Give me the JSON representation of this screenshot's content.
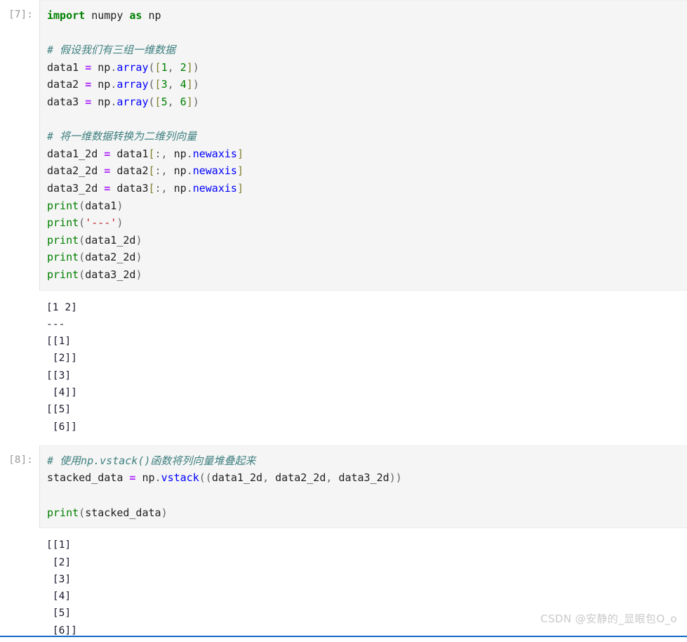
{
  "notebook": {
    "cells": [
      {
        "id": "cell-7",
        "prompt": "[7]:",
        "input_lines": [
          [
            {
              "t": "import",
              "c": "kw"
            },
            {
              "t": " ",
              "c": "op"
            },
            {
              "t": "numpy",
              "c": "name"
            },
            {
              "t": " ",
              "c": "op"
            },
            {
              "t": "as",
              "c": "kw"
            },
            {
              "t": " ",
              "c": "op"
            },
            {
              "t": "np",
              "c": "name"
            }
          ],
          [],
          [
            {
              "t": "# 假设我们有三组一维数据",
              "c": "comment"
            }
          ],
          [
            {
              "t": "data1 ",
              "c": "name"
            },
            {
              "t": "=",
              "c": "assign"
            },
            {
              "t": " np",
              "c": "name"
            },
            {
              "t": ".",
              "c": "op"
            },
            {
              "t": "array",
              "c": "func"
            },
            {
              "t": "(",
              "c": "op"
            },
            {
              "t": "[",
              "c": "brack"
            },
            {
              "t": "1",
              "c": "num"
            },
            {
              "t": ", ",
              "c": "op"
            },
            {
              "t": "2",
              "c": "num"
            },
            {
              "t": "]",
              "c": "brack"
            },
            {
              "t": ")",
              "c": "op"
            }
          ],
          [
            {
              "t": "data2 ",
              "c": "name"
            },
            {
              "t": "=",
              "c": "assign"
            },
            {
              "t": " np",
              "c": "name"
            },
            {
              "t": ".",
              "c": "op"
            },
            {
              "t": "array",
              "c": "func"
            },
            {
              "t": "(",
              "c": "op"
            },
            {
              "t": "[",
              "c": "brack"
            },
            {
              "t": "3",
              "c": "num"
            },
            {
              "t": ", ",
              "c": "op"
            },
            {
              "t": "4",
              "c": "num"
            },
            {
              "t": "]",
              "c": "brack"
            },
            {
              "t": ")",
              "c": "op"
            }
          ],
          [
            {
              "t": "data3 ",
              "c": "name"
            },
            {
              "t": "=",
              "c": "assign"
            },
            {
              "t": " np",
              "c": "name"
            },
            {
              "t": ".",
              "c": "op"
            },
            {
              "t": "array",
              "c": "func"
            },
            {
              "t": "(",
              "c": "op"
            },
            {
              "t": "[",
              "c": "brack"
            },
            {
              "t": "5",
              "c": "num"
            },
            {
              "t": ", ",
              "c": "op"
            },
            {
              "t": "6",
              "c": "num"
            },
            {
              "t": "]",
              "c": "brack"
            },
            {
              "t": ")",
              "c": "op"
            }
          ],
          [],
          [
            {
              "t": "# 将一维数据转换为二维列向量",
              "c": "comment"
            }
          ],
          [
            {
              "t": "data1_2d ",
              "c": "name"
            },
            {
              "t": "=",
              "c": "assign"
            },
            {
              "t": " data1",
              "c": "name"
            },
            {
              "t": "[",
              "c": "brack"
            },
            {
              "t": ":, ",
              "c": "op"
            },
            {
              "t": "np",
              "c": "name"
            },
            {
              "t": ".",
              "c": "op"
            },
            {
              "t": "newaxis",
              "c": "func"
            },
            {
              "t": "]",
              "c": "brack"
            }
          ],
          [
            {
              "t": "data2_2d ",
              "c": "name"
            },
            {
              "t": "=",
              "c": "assign"
            },
            {
              "t": " data2",
              "c": "name"
            },
            {
              "t": "[",
              "c": "brack"
            },
            {
              "t": ":, ",
              "c": "op"
            },
            {
              "t": "np",
              "c": "name"
            },
            {
              "t": ".",
              "c": "op"
            },
            {
              "t": "newaxis",
              "c": "func"
            },
            {
              "t": "]",
              "c": "brack"
            }
          ],
          [
            {
              "t": "data3_2d ",
              "c": "name"
            },
            {
              "t": "=",
              "c": "assign"
            },
            {
              "t": " data3",
              "c": "name"
            },
            {
              "t": "[",
              "c": "brack"
            },
            {
              "t": ":, ",
              "c": "op"
            },
            {
              "t": "np",
              "c": "name"
            },
            {
              "t": ".",
              "c": "op"
            },
            {
              "t": "newaxis",
              "c": "func"
            },
            {
              "t": "]",
              "c": "brack"
            }
          ],
          [
            {
              "t": "print",
              "c": "builtin"
            },
            {
              "t": "(",
              "c": "op"
            },
            {
              "t": "data1",
              "c": "name"
            },
            {
              "t": ")",
              "c": "op"
            }
          ],
          [
            {
              "t": "print",
              "c": "builtin"
            },
            {
              "t": "(",
              "c": "op"
            },
            {
              "t": "'---'",
              "c": "str"
            },
            {
              "t": ")",
              "c": "op"
            }
          ],
          [
            {
              "t": "print",
              "c": "builtin"
            },
            {
              "t": "(",
              "c": "op"
            },
            {
              "t": "data1_2d",
              "c": "name"
            },
            {
              "t": ")",
              "c": "op"
            }
          ],
          [
            {
              "t": "print",
              "c": "builtin"
            },
            {
              "t": "(",
              "c": "op"
            },
            {
              "t": "data2_2d",
              "c": "name"
            },
            {
              "t": ")",
              "c": "op"
            }
          ],
          [
            {
              "t": "print",
              "c": "builtin"
            },
            {
              "t": "(",
              "c": "op"
            },
            {
              "t": "data3_2d",
              "c": "name"
            },
            {
              "t": ")",
              "c": "op"
            }
          ]
        ],
        "output_lines": [
          "[1 2]",
          "---",
          "[[1]",
          " [2]]",
          "[[3]",
          " [4]]",
          "[[5]",
          " [6]]"
        ]
      },
      {
        "id": "cell-8",
        "prompt": "[8]:",
        "input_lines": [
          [
            {
              "t": "# 使用np.vstack()函数将列向量堆叠起来",
              "c": "comment"
            }
          ],
          [
            {
              "t": "stacked_data ",
              "c": "name"
            },
            {
              "t": "=",
              "c": "assign"
            },
            {
              "t": " np",
              "c": "name"
            },
            {
              "t": ".",
              "c": "op"
            },
            {
              "t": "vstack",
              "c": "func"
            },
            {
              "t": "((",
              "c": "op"
            },
            {
              "t": "data1_2d",
              "c": "name"
            },
            {
              "t": ", ",
              "c": "op"
            },
            {
              "t": "data2_2d",
              "c": "name"
            },
            {
              "t": ", ",
              "c": "op"
            },
            {
              "t": "data3_2d",
              "c": "name"
            },
            {
              "t": "))",
              "c": "op"
            }
          ],
          [],
          [
            {
              "t": "print",
              "c": "builtin"
            },
            {
              "t": "(",
              "c": "op"
            },
            {
              "t": "stacked_data",
              "c": "name"
            },
            {
              "t": ")",
              "c": "op"
            }
          ]
        ],
        "output_lines": [
          "[[1]",
          " [2]",
          " [3]",
          " [4]",
          " [5]",
          " [6]]"
        ]
      }
    ]
  },
  "watermark": {
    "text": "CSDN @安静的_显眼包O_o"
  },
  "colors": {
    "cell_background": "#f5f5f5",
    "output_background": "#ffffff",
    "prompt": "#999999",
    "keyword": "#008000",
    "builtin": "#008000",
    "function": "#0000ff",
    "assign": "#aa22ff",
    "string": "#ba2121",
    "number": "#008000",
    "bracket": "#808030",
    "comment": "#408080",
    "output_text": "#1a1a2e",
    "bottom_rule": "#1368c6",
    "watermark": "#c9c9c9"
  }
}
